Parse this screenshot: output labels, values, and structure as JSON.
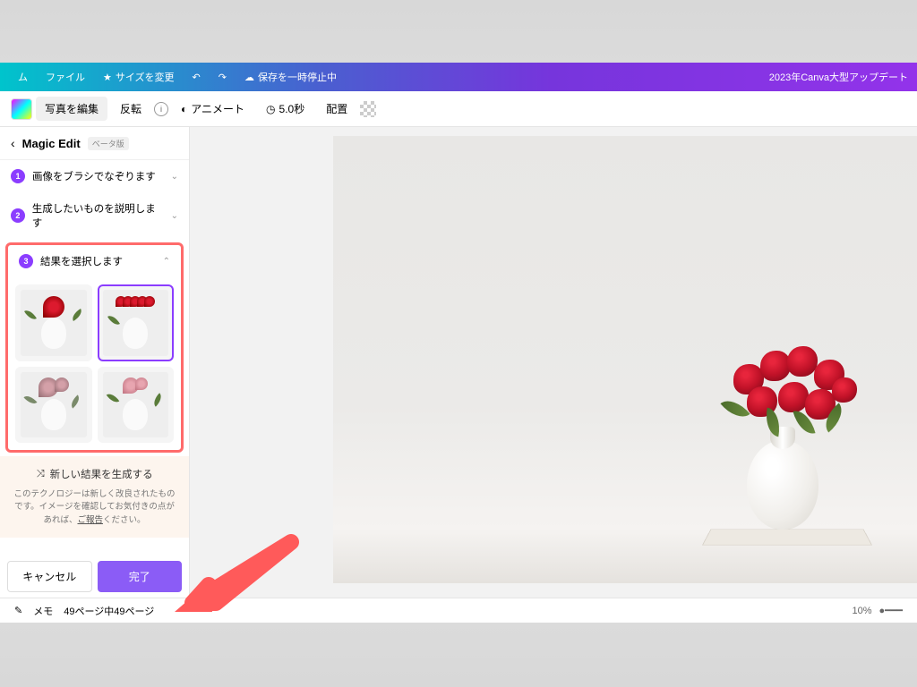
{
  "topbar": {
    "home": "ム",
    "file": "ファイル",
    "resize": "サイズを変更",
    "save_status": "保存を一時停止中",
    "announcement": "2023年Canva大型アップデート"
  },
  "sidebar": {
    "title": "Magic Edit",
    "beta": "ベータ版",
    "steps": {
      "s1": "画像をブラシでなぞります",
      "s2": "生成したいものを説明します",
      "s3": "結果を選択します"
    },
    "generate": "新しい結果を生成する",
    "disclaimer_prefix": "このテクノロジーは新しく改良されたものです。イメージを確認してお気付きの点があれば、",
    "disclaimer_link": "ご報告",
    "disclaimer_suffix": "ください。",
    "cancel": "キャンセル",
    "done": "完了"
  },
  "toolbar": {
    "edit_photo": "写真を編集",
    "flip": "反転",
    "animate": "アニメート",
    "duration": "5.0秒",
    "position": "配置"
  },
  "bottombar": {
    "notes": "メモ",
    "pages": "49ページ中49ページ",
    "zoom": "10%"
  }
}
